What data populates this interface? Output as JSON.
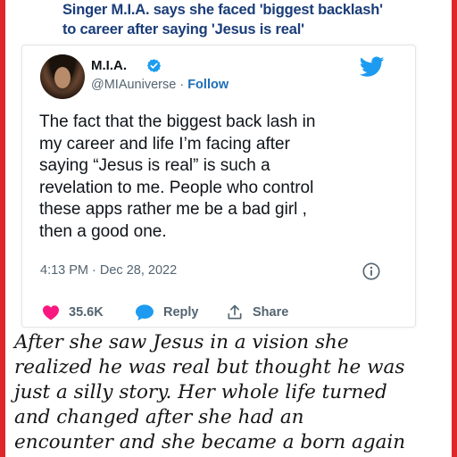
{
  "headline": {
    "lines": [
      "Singer M.I.A. says she faced 'biggest backlash'",
      "to career after saying 'Jesus is real'"
    ]
  },
  "tweet": {
    "display_name": "M.I.A.",
    "handle": "@MIAuniverse",
    "separator": " · ",
    "follow_label": "Follow",
    "text_lines": [
      "The fact that the biggest  back lash in",
      "my career and life I’m facing  after",
      "saying “Jesus is real” is such a",
      "revelation to me. People who control",
      "these apps rather me be a bad girl ,",
      "then a good one."
    ],
    "timestamp": "4:13 PM · Dec 28, 2022",
    "likes": "35.6K",
    "reply_label": "Reply",
    "share_label": "Share",
    "icons": {
      "verified": "verified-badge-icon",
      "brand": "twitter-bird-icon",
      "info": "info-icon",
      "like": "heart-icon",
      "reply": "speech-bubble-icon",
      "share": "share-upload-icon"
    },
    "colors": {
      "twitter_blue": "#1d9bf0",
      "heart_red": "#f91880",
      "follow_blue": "#1d6fb8"
    }
  },
  "caption": {
    "lines": [
      "After she saw Jesus in a vision she",
      "realized he was real but thought he was",
      "just a silly story. Her whole life turned",
      "and changed  after she had an",
      "encounter and she became a born again"
    ]
  },
  "frame": {
    "border_color": "#e0242b",
    "headline_color": "#1a3d7a"
  }
}
